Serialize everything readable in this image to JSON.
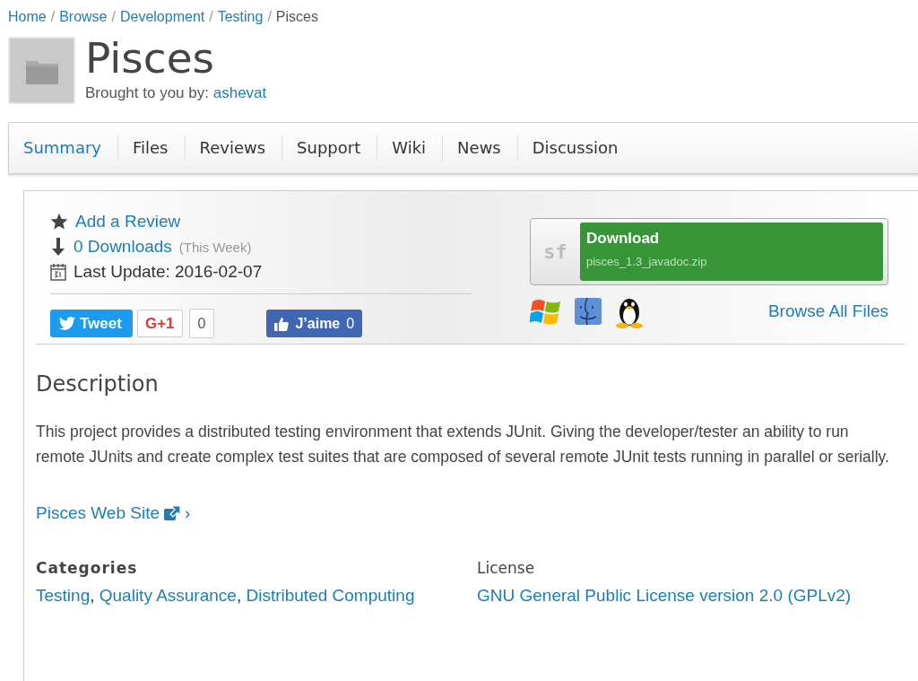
{
  "breadcrumb": {
    "links": [
      "Home",
      "Browse",
      "Development",
      "Testing"
    ],
    "separator": "/",
    "current": "Pisces"
  },
  "project": {
    "title": "Pisces",
    "byline": "Brought to you by:",
    "author": "ashevat"
  },
  "tabs": [
    {
      "label": "Summary",
      "selected": true
    },
    {
      "label": "Files",
      "selected": false
    },
    {
      "label": "Reviews",
      "selected": false
    },
    {
      "label": "Support",
      "selected": false
    },
    {
      "label": "Wiki",
      "selected": false
    },
    {
      "label": "News",
      "selected": false
    },
    {
      "label": "Discussion",
      "selected": false
    }
  ],
  "stats": {
    "review_link": "Add a Review",
    "downloads": "0 Downloads",
    "downloads_period": "(This Week)",
    "last_update": "Last Update: 2016-02-07"
  },
  "social": {
    "tweet": "Tweet",
    "gplus": "G+1",
    "gplus_count": "0",
    "like": "J’aime",
    "like_count": "0"
  },
  "download": {
    "label": "Download",
    "filename": "pisces_1.3_javadoc.zip",
    "logo": "sf",
    "browse_link": "Browse All Files"
  },
  "description": {
    "heading": "Description",
    "text": "This project provides a distributed testing environment that extends JUnit. Giving the developer/tester an ability to run remote JUnits and create complex test suites that are composed of several remote JUnit tests running in parallel or serially.",
    "website": "Pisces Web Site",
    "website_arrow": "›"
  },
  "categories": {
    "heading": "Categories",
    "separator": ",",
    "items": [
      "Testing",
      "Quality Assurance",
      "Distributed Computing"
    ]
  },
  "license": {
    "heading": "License",
    "value": "GNU General Public License version 2.0 (GPLv2)"
  }
}
